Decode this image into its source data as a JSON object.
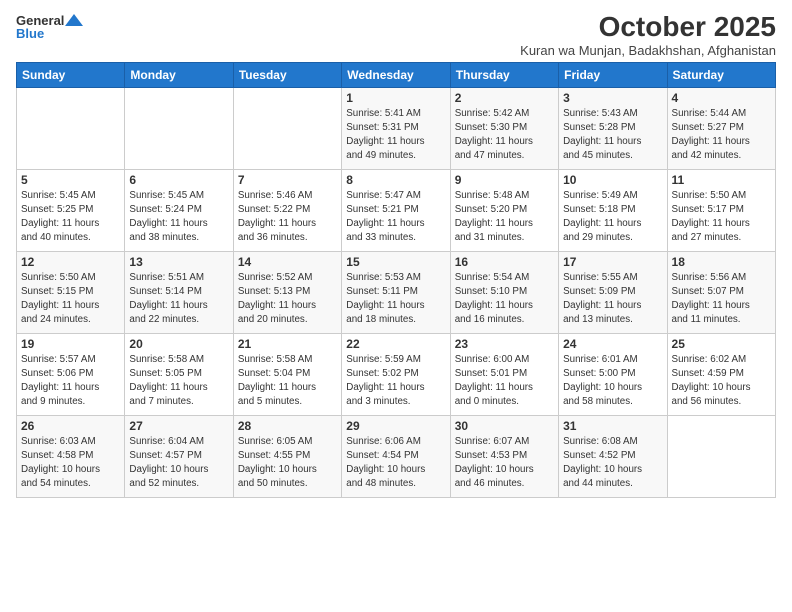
{
  "header": {
    "logo_general": "General",
    "logo_blue": "Blue",
    "title": "October 2025",
    "subtitle": "Kuran wa Munjan, Badakhshan, Afghanistan"
  },
  "days_of_week": [
    "Sunday",
    "Monday",
    "Tuesday",
    "Wednesday",
    "Thursday",
    "Friday",
    "Saturday"
  ],
  "weeks": [
    [
      {
        "day": "",
        "text": ""
      },
      {
        "day": "",
        "text": ""
      },
      {
        "day": "",
        "text": ""
      },
      {
        "day": "1",
        "text": "Sunrise: 5:41 AM\nSunset: 5:31 PM\nDaylight: 11 hours\nand 49 minutes."
      },
      {
        "day": "2",
        "text": "Sunrise: 5:42 AM\nSunset: 5:30 PM\nDaylight: 11 hours\nand 47 minutes."
      },
      {
        "day": "3",
        "text": "Sunrise: 5:43 AM\nSunset: 5:28 PM\nDaylight: 11 hours\nand 45 minutes."
      },
      {
        "day": "4",
        "text": "Sunrise: 5:44 AM\nSunset: 5:27 PM\nDaylight: 11 hours\nand 42 minutes."
      }
    ],
    [
      {
        "day": "5",
        "text": "Sunrise: 5:45 AM\nSunset: 5:25 PM\nDaylight: 11 hours\nand 40 minutes."
      },
      {
        "day": "6",
        "text": "Sunrise: 5:45 AM\nSunset: 5:24 PM\nDaylight: 11 hours\nand 38 minutes."
      },
      {
        "day": "7",
        "text": "Sunrise: 5:46 AM\nSunset: 5:22 PM\nDaylight: 11 hours\nand 36 minutes."
      },
      {
        "day": "8",
        "text": "Sunrise: 5:47 AM\nSunset: 5:21 PM\nDaylight: 11 hours\nand 33 minutes."
      },
      {
        "day": "9",
        "text": "Sunrise: 5:48 AM\nSunset: 5:20 PM\nDaylight: 11 hours\nand 31 minutes."
      },
      {
        "day": "10",
        "text": "Sunrise: 5:49 AM\nSunset: 5:18 PM\nDaylight: 11 hours\nand 29 minutes."
      },
      {
        "day": "11",
        "text": "Sunrise: 5:50 AM\nSunset: 5:17 PM\nDaylight: 11 hours\nand 27 minutes."
      }
    ],
    [
      {
        "day": "12",
        "text": "Sunrise: 5:50 AM\nSunset: 5:15 PM\nDaylight: 11 hours\nand 24 minutes."
      },
      {
        "day": "13",
        "text": "Sunrise: 5:51 AM\nSunset: 5:14 PM\nDaylight: 11 hours\nand 22 minutes."
      },
      {
        "day": "14",
        "text": "Sunrise: 5:52 AM\nSunset: 5:13 PM\nDaylight: 11 hours\nand 20 minutes."
      },
      {
        "day": "15",
        "text": "Sunrise: 5:53 AM\nSunset: 5:11 PM\nDaylight: 11 hours\nand 18 minutes."
      },
      {
        "day": "16",
        "text": "Sunrise: 5:54 AM\nSunset: 5:10 PM\nDaylight: 11 hours\nand 16 minutes."
      },
      {
        "day": "17",
        "text": "Sunrise: 5:55 AM\nSunset: 5:09 PM\nDaylight: 11 hours\nand 13 minutes."
      },
      {
        "day": "18",
        "text": "Sunrise: 5:56 AM\nSunset: 5:07 PM\nDaylight: 11 hours\nand 11 minutes."
      }
    ],
    [
      {
        "day": "19",
        "text": "Sunrise: 5:57 AM\nSunset: 5:06 PM\nDaylight: 11 hours\nand 9 minutes."
      },
      {
        "day": "20",
        "text": "Sunrise: 5:58 AM\nSunset: 5:05 PM\nDaylight: 11 hours\nand 7 minutes."
      },
      {
        "day": "21",
        "text": "Sunrise: 5:58 AM\nSunset: 5:04 PM\nDaylight: 11 hours\nand 5 minutes."
      },
      {
        "day": "22",
        "text": "Sunrise: 5:59 AM\nSunset: 5:02 PM\nDaylight: 11 hours\nand 3 minutes."
      },
      {
        "day": "23",
        "text": "Sunrise: 6:00 AM\nSunset: 5:01 PM\nDaylight: 11 hours\nand 0 minutes."
      },
      {
        "day": "24",
        "text": "Sunrise: 6:01 AM\nSunset: 5:00 PM\nDaylight: 10 hours\nand 58 minutes."
      },
      {
        "day": "25",
        "text": "Sunrise: 6:02 AM\nSunset: 4:59 PM\nDaylight: 10 hours\nand 56 minutes."
      }
    ],
    [
      {
        "day": "26",
        "text": "Sunrise: 6:03 AM\nSunset: 4:58 PM\nDaylight: 10 hours\nand 54 minutes."
      },
      {
        "day": "27",
        "text": "Sunrise: 6:04 AM\nSunset: 4:57 PM\nDaylight: 10 hours\nand 52 minutes."
      },
      {
        "day": "28",
        "text": "Sunrise: 6:05 AM\nSunset: 4:55 PM\nDaylight: 10 hours\nand 50 minutes."
      },
      {
        "day": "29",
        "text": "Sunrise: 6:06 AM\nSunset: 4:54 PM\nDaylight: 10 hours\nand 48 minutes."
      },
      {
        "day": "30",
        "text": "Sunrise: 6:07 AM\nSunset: 4:53 PM\nDaylight: 10 hours\nand 46 minutes."
      },
      {
        "day": "31",
        "text": "Sunrise: 6:08 AM\nSunset: 4:52 PM\nDaylight: 10 hours\nand 44 minutes."
      },
      {
        "day": "",
        "text": ""
      }
    ]
  ]
}
